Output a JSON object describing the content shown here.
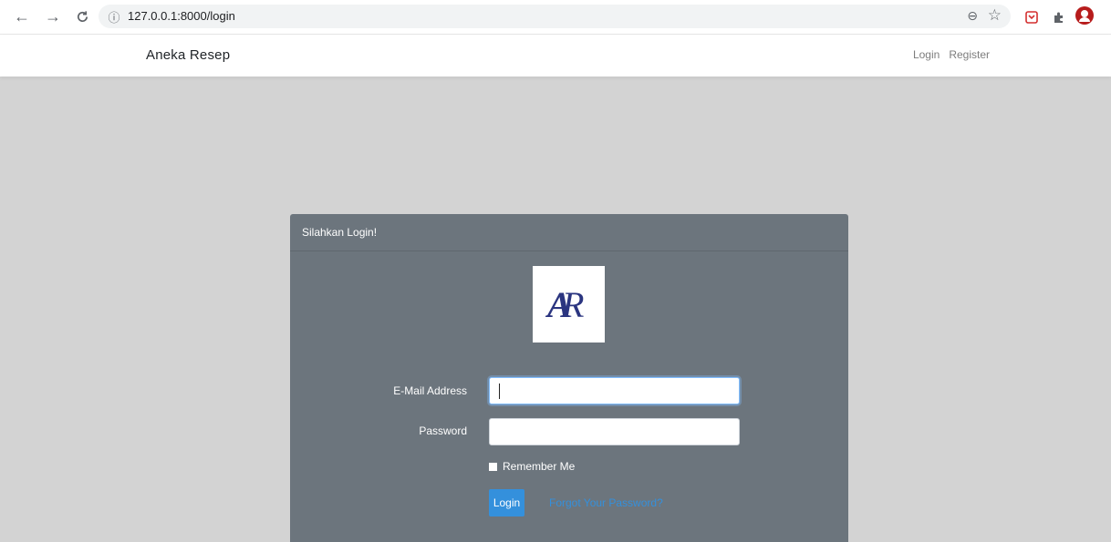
{
  "browser": {
    "url": "127.0.0.1:8000/login"
  },
  "navbar": {
    "brand": "Aneka Resep",
    "links": [
      "Login",
      "Register"
    ]
  },
  "card": {
    "header": "Silahkan Login!",
    "logo_text": "AR",
    "email_label": "E-Mail Address",
    "email_value": "",
    "password_label": "Password",
    "password_value": "",
    "remember_label": "Remember Me",
    "login_button": "Login",
    "forgot_link": "Forgot Your Password?"
  },
  "colors": {
    "page_bg": "#d3d3d3",
    "card_bg": "#6c757d",
    "primary": "#3490dc",
    "logo_navy": "#2b3580"
  }
}
